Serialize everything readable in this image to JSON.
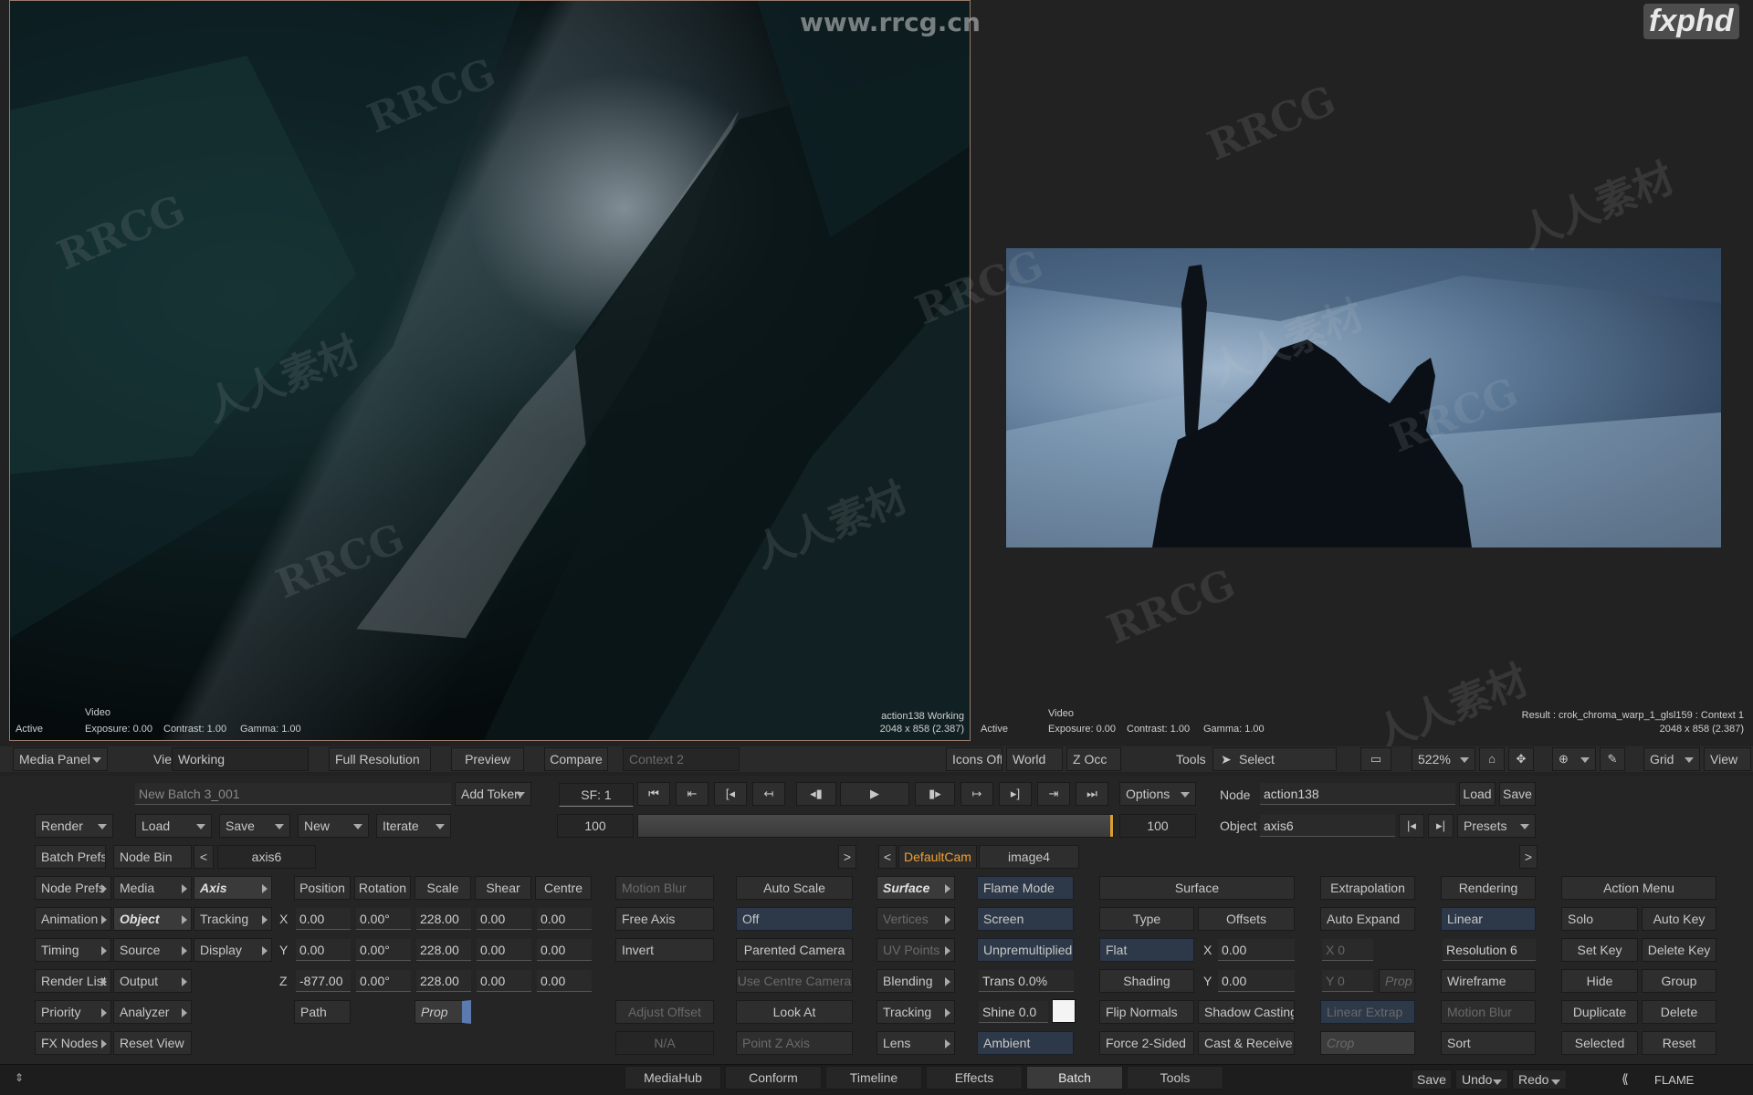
{
  "watermarks": {
    "site": "www.rrcg.cn",
    "brand": "fxphd",
    "text1": "RRCG",
    "text2": "人人素材"
  },
  "left_viewer": {
    "active": "Active",
    "video": "Video",
    "exposure": "Exposure: 0.00",
    "contrast": "Contrast: 1.00",
    "gamma": "Gamma: 1.00",
    "info1": "action138 Working",
    "info2": "2048 x 858 (2.387)"
  },
  "right_viewer": {
    "active": "Active",
    "video": "Video",
    "exposure": "Exposure: 0.00",
    "contrast": "Contrast: 1.00",
    "gamma": "Gamma: 1.00",
    "info1": "Result : crok_chroma_warp_1_glsl159 : Context 1",
    "info2": "2048 x 858 (2.387)"
  },
  "toolbar": {
    "media_panel": "Media Panel",
    "viewing_label": "Viewing",
    "viewing_value": "Working",
    "full_resolution": "Full Resolution",
    "preview": "Preview",
    "compare": "Compare",
    "context": "Context 2",
    "icons_off": "Icons Off",
    "world": "World",
    "z_occ": "Z Occ",
    "tools_label": "Tools",
    "select": "Select",
    "zoom": "522%",
    "grid": "Grid",
    "view": "View"
  },
  "batch": {
    "name": "New Batch 3_001",
    "add_token": "Add Token",
    "render": "Render",
    "load": "Load",
    "save": "Save",
    "new": "New",
    "iterate": "Iterate",
    "batch_prefs": "Batch Prefs",
    "node_bin": "Node Bin",
    "current_node": "axis6"
  },
  "transport": {
    "sf": "SF: 1",
    "start": "100",
    "end": "100"
  },
  "node_panel": {
    "options": "Options",
    "node_label": "Node",
    "node_value": "action138",
    "load": "Load",
    "save": "Save",
    "object_label": "Object",
    "object_value": "axis6",
    "presets": "Presets"
  },
  "tabs": {
    "left_arrow": "<",
    "right_arrow": ">",
    "cam": "DefaultCam",
    "image": "image4"
  },
  "menu_col1": [
    "Node Prefs",
    "Animation",
    "Timing",
    "Render List",
    "Priority",
    "FX Nodes"
  ],
  "menu_col2": [
    "Media",
    "Object",
    "Source",
    "Output",
    "Analyzer",
    "Reset View"
  ],
  "menu_col3": [
    "Axis",
    "Tracking",
    "Display"
  ],
  "axis": {
    "headers": [
      "Position",
      "Rotation",
      "Scale",
      "Shear",
      "Centre"
    ],
    "rows": [
      {
        "axis": "X",
        "values": [
          "0.00",
          "0.00°",
          "228.00",
          "0.00",
          "0.00"
        ]
      },
      {
        "axis": "Y",
        "values": [
          "0.00",
          "0.00°",
          "228.00",
          "0.00",
          "0.00"
        ]
      },
      {
        "axis": "Z",
        "values": [
          "-877.00",
          "0.00°",
          "228.00",
          "0.00",
          "0.00"
        ]
      }
    ],
    "path": "Path",
    "prop": "Prop"
  },
  "col_motion": {
    "motion_blur": "Motion Blur",
    "free_axis": "Free Axis",
    "invert": "Invert",
    "adjust_offset": "Adjust Offset",
    "na": "N/A"
  },
  "col_autoscale": {
    "auto_scale": "Auto Scale",
    "off": "Off",
    "parented_camera": "Parented Camera",
    "use_centre_camera": "Use Centre Camera",
    "look_at": "Look At",
    "point_z_axis": "Point Z Axis"
  },
  "col_surface": [
    "Surface",
    "Vertices",
    "UV Points",
    "Blending",
    "Tracking",
    "Lens"
  ],
  "col_flame": {
    "flame_mode": "Flame Mode",
    "screen": "Screen",
    "unpremultiplied": "Unpremultiplied",
    "trans": "Trans 0.0%",
    "shine": "Shine 0.0",
    "ambient": "Ambient"
  },
  "col_surf2": {
    "surface": "Surface",
    "type": "Type",
    "offsets": "Offsets",
    "flat": "Flat",
    "x": "X",
    "x_val": "0.00",
    "shading": "Shading",
    "y": "Y",
    "y_val": "0.00",
    "flip_normals": "Flip Normals",
    "shadow_casting": "Shadow Casting",
    "force2": "Force 2-Sided",
    "cast_receive": "Cast & Receive"
  },
  "col_extrap": {
    "extrapolation": "Extrapolation",
    "auto_expand": "Auto Expand",
    "x0": "X 0",
    "y0": "Y 0",
    "prop": "Prop",
    "linear_extrap": "Linear Extrap",
    "crop": "Crop"
  },
  "col_render": {
    "rendering": "Rendering",
    "linear": "Linear",
    "resolution": "Resolution 6",
    "wireframe": "Wireframe",
    "motion_blur": "Motion Blur",
    "sort": "Sort"
  },
  "col_action": {
    "action_menu": "Action Menu",
    "solo": "Solo",
    "auto_key": "Auto Key",
    "set_key": "Set Key",
    "delete_key": "Delete Key",
    "hide": "Hide",
    "group": "Group",
    "duplicate": "Duplicate",
    "delete": "Delete",
    "selected": "Selected",
    "reset": "Reset"
  },
  "bottom": {
    "tabs": [
      "MediaHub",
      "Conform",
      "Timeline",
      "Effects",
      "Batch",
      "Tools"
    ],
    "save": "Save",
    "undo": "Undo",
    "redo": "Redo",
    "app": "FLAME"
  }
}
